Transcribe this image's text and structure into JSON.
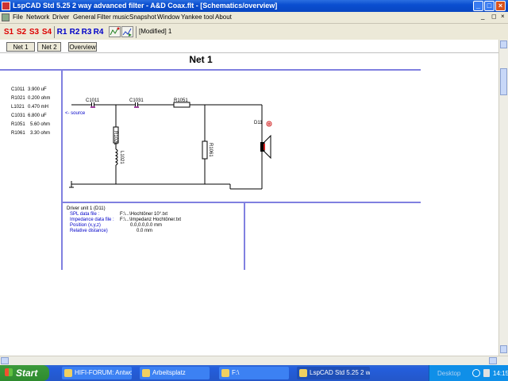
{
  "window": {
    "title": "LspCAD Std 5.25 2 way advanced filter - A&D Coax.flt - [Schematics/overview]",
    "controls": [
      "_",
      "□",
      "×"
    ],
    "mdi_controls": [
      "_",
      "◻",
      "×"
    ]
  },
  "menu": [
    "File",
    "Network",
    "Driver",
    "General",
    "Filter music",
    "Snapshot",
    "Window",
    "Yankee tool",
    "About"
  ],
  "toolbar": {
    "sections": [
      "S1",
      "S2",
      "S3",
      "S4"
    ],
    "rooms": [
      "R1",
      "R2",
      "R3",
      "R4"
    ],
    "status": "[Modified] 1"
  },
  "nav": {
    "buttons": [
      "Net 1",
      "Net 2",
      "Overview"
    ],
    "heading": "Net 1"
  },
  "parts": [
    {
      "name": "C1011",
      "value": "3.900 uF"
    },
    {
      "name": "R1021",
      "value": "0.200 ohm"
    },
    {
      "name": "L1021",
      "value": "0.470 mH"
    },
    {
      "name": "C1031",
      "value": "6.800 uF"
    },
    {
      "name": "R1051",
      "value": "5.60 ohm"
    },
    {
      "name": "R1061",
      "value": "3.30 ohm"
    }
  ],
  "schematic": {
    "labels": {
      "c1011": "C1011",
      "c1031": "C1031",
      "r1051": "R1051",
      "r1021": "R1021",
      "l1021": "L1021",
      "r1061": "R1061",
      "d11": "D11",
      "source": "<- source"
    }
  },
  "driver_info": {
    "header": "Driver unit 1 (D11)",
    "rows": [
      {
        "label": "SPL data file :",
        "value": "F:\\...\\Hochtöner 10°.txt"
      },
      {
        "label": "Impedance data file :",
        "value": "F:\\...\\Impedanz Hochtöner.txt"
      },
      {
        "label": "Position (x,y,z)",
        "value": "0.0,0.0,0.0 mm"
      },
      {
        "label": "Relative distance)",
        "value": "0.0 mm"
      }
    ]
  },
  "taskbar": {
    "start": "Start",
    "tasks": [
      "HIFI-FORUM: Antwor...",
      "Arbeitsplatz",
      "F:\\",
      "LspCAD Std 5.25 2 w..."
    ],
    "desktop": "Desktop",
    "clock": "14:15"
  }
}
